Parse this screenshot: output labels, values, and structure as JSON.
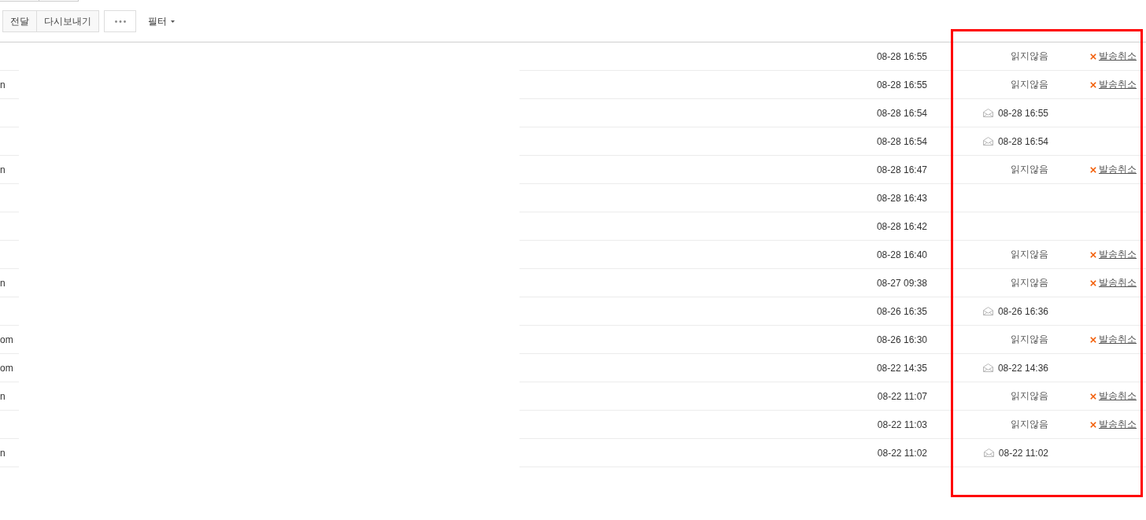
{
  "toolbar": [
    {
      "kind": "group",
      "buttons": [
        "전달",
        "다시보내기"
      ]
    },
    {
      "kind": "more"
    },
    {
      "kind": "dropdown",
      "label": "필터"
    }
  ],
  "rows": [
    {
      "time": "08-28 16:55",
      "status": {
        "kind": "unread",
        "label": "읽지않음"
      },
      "action": "발송취소"
    },
    {
      "column_1": "n",
      "time": "08-28 16:55",
      "status": {
        "kind": "unread",
        "label": "읽지않음"
      },
      "action": "발송취소"
    },
    {
      "time": "08-28 16:54",
      "status": {
        "kind": "opened",
        "time": "08-28 16:55"
      }
    },
    {
      "time": "08-28 16:54",
      "status": {
        "kind": "opened",
        "time": "08-28 16:54"
      }
    },
    {
      "column_1": "n",
      "time": "08-28 16:47",
      "status": {
        "kind": "unread",
        "label": "읽지않음"
      },
      "action": "발송취소"
    },
    {
      "time": "08-28 16:43"
    },
    {
      "time": "08-28 16:42"
    },
    {
      "time": "08-28 16:40",
      "status": {
        "kind": "unread",
        "label": "읽지않음"
      },
      "action": "발송취소"
    },
    {
      "column_1": "n",
      "time": "08-27 09:38",
      "status": {
        "kind": "unread",
        "label": "읽지않음"
      },
      "action": "발송취소"
    },
    {
      "time": "08-26 16:35",
      "status": {
        "kind": "opened",
        "time": "08-26 16:36"
      }
    },
    {
      "column_1": "om",
      "time": "08-26 16:30",
      "status": {
        "kind": "unread",
        "label": "읽지않음"
      },
      "action": "발송취소"
    },
    {
      "column_1": "om",
      "time": "08-22 14:35",
      "status": {
        "kind": "opened",
        "time": "08-22 14:36"
      }
    },
    {
      "column_1": "n",
      "time": "08-22 11:07",
      "status": {
        "kind": "unread",
        "label": "읽지않음"
      },
      "action": "발송취소"
    },
    {
      "time": "08-22 11:03",
      "status": {
        "kind": "unread",
        "label": "읽지않음"
      },
      "action": "발송취소"
    },
    {
      "column_1": "n",
      "time": "08-22 11:02",
      "status": {
        "kind": "opened",
        "time": "08-22 11:02"
      }
    }
  ],
  "annotations": [
    {
      "kind": "frame"
    }
  ]
}
